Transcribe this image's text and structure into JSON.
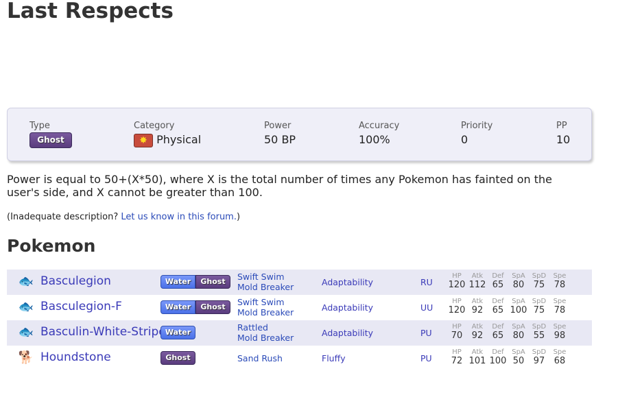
{
  "title": "Last Respects",
  "move": {
    "type_label": "Type",
    "type": "Ghost",
    "category_label": "Category",
    "category": "Physical",
    "power_label": "Power",
    "power": "50 BP",
    "accuracy_label": "Accuracy",
    "accuracy": "100%",
    "priority_label": "Priority",
    "priority": "0",
    "pp_label": "PP",
    "pp": "10"
  },
  "description": "Power is equal to 50+(X*50), where X is the total number of times any Pokemon has fainted on the user's side, and X cannot be greater than 100.",
  "feedback": {
    "prefix": "(Inadequate description? ",
    "link": "Let us know in this forum.",
    "suffix": ")"
  },
  "pokemon_heading": "Pokemon",
  "stat_labels": [
    "HP",
    "Atk",
    "Def",
    "SpA",
    "SpD",
    "Spe"
  ],
  "pokemon": [
    {
      "name": "Basculegion",
      "types": [
        "Water",
        "Ghost"
      ],
      "abilities": [
        "Swift Swim",
        "Mold Breaker"
      ],
      "hidden": "Adaptability",
      "tier": "RU",
      "stats": [
        "120",
        "112",
        "65",
        "80",
        "75",
        "78"
      ]
    },
    {
      "name": "Basculegion-F",
      "types": [
        "Water",
        "Ghost"
      ],
      "abilities": [
        "Swift Swim",
        "Mold Breaker"
      ],
      "hidden": "Adaptability",
      "tier": "UU",
      "stats": [
        "120",
        "92",
        "65",
        "100",
        "75",
        "78"
      ]
    },
    {
      "name": "Basculin-White-Striped",
      "types": [
        "Water"
      ],
      "abilities": [
        "Rattled",
        "Mold Breaker"
      ],
      "hidden": "Adaptability",
      "tier": "PU",
      "stats": [
        "70",
        "92",
        "65",
        "80",
        "55",
        "98"
      ]
    },
    {
      "name": "Houndstone",
      "types": [
        "Ghost"
      ],
      "abilities": [
        "Sand Rush"
      ],
      "hidden": "Fluffy",
      "tier": "PU",
      "stats": [
        "72",
        "101",
        "100",
        "50",
        "97",
        "68"
      ]
    }
  ]
}
